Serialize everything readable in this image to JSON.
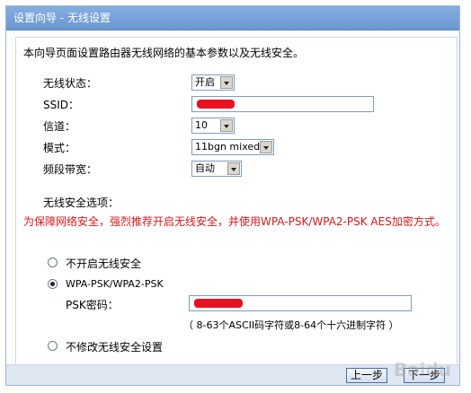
{
  "window": {
    "title": "设置向导 - 无线设置"
  },
  "intro": "本向导页面设置路由器无线网络的基本参数以及无线安全。",
  "fields": {
    "wireless_status": {
      "label": "无线状态：",
      "value": "开启"
    },
    "ssid": {
      "label": "SSID：",
      "value": ""
    },
    "channel": {
      "label": "信道：",
      "value": "10"
    },
    "mode": {
      "label": "模式：",
      "value": "11bgn mixed"
    },
    "bandwidth": {
      "label": "频段带宽：",
      "value": "自动"
    }
  },
  "security": {
    "heading": "无线安全选项：",
    "warning": "为保障网络安全，强烈推荐开启无线安全，并使用WPA-PSK/WPA2-PSK AES加密方式。",
    "options": [
      {
        "label": "不开启无线安全",
        "checked": false
      },
      {
        "label": "WPA-PSK/WPA2-PSK",
        "checked": true
      },
      {
        "label": "不修改无线安全设置",
        "checked": false
      }
    ],
    "psk": {
      "label": "PSK密码：",
      "value": ""
    },
    "psk_hint": "（ 8-63个ASCII码字符或8-64个十六进制字符 ）"
  },
  "buttons": {
    "back": "上一步",
    "next": "下一步"
  },
  "watermark": "Baidu"
}
